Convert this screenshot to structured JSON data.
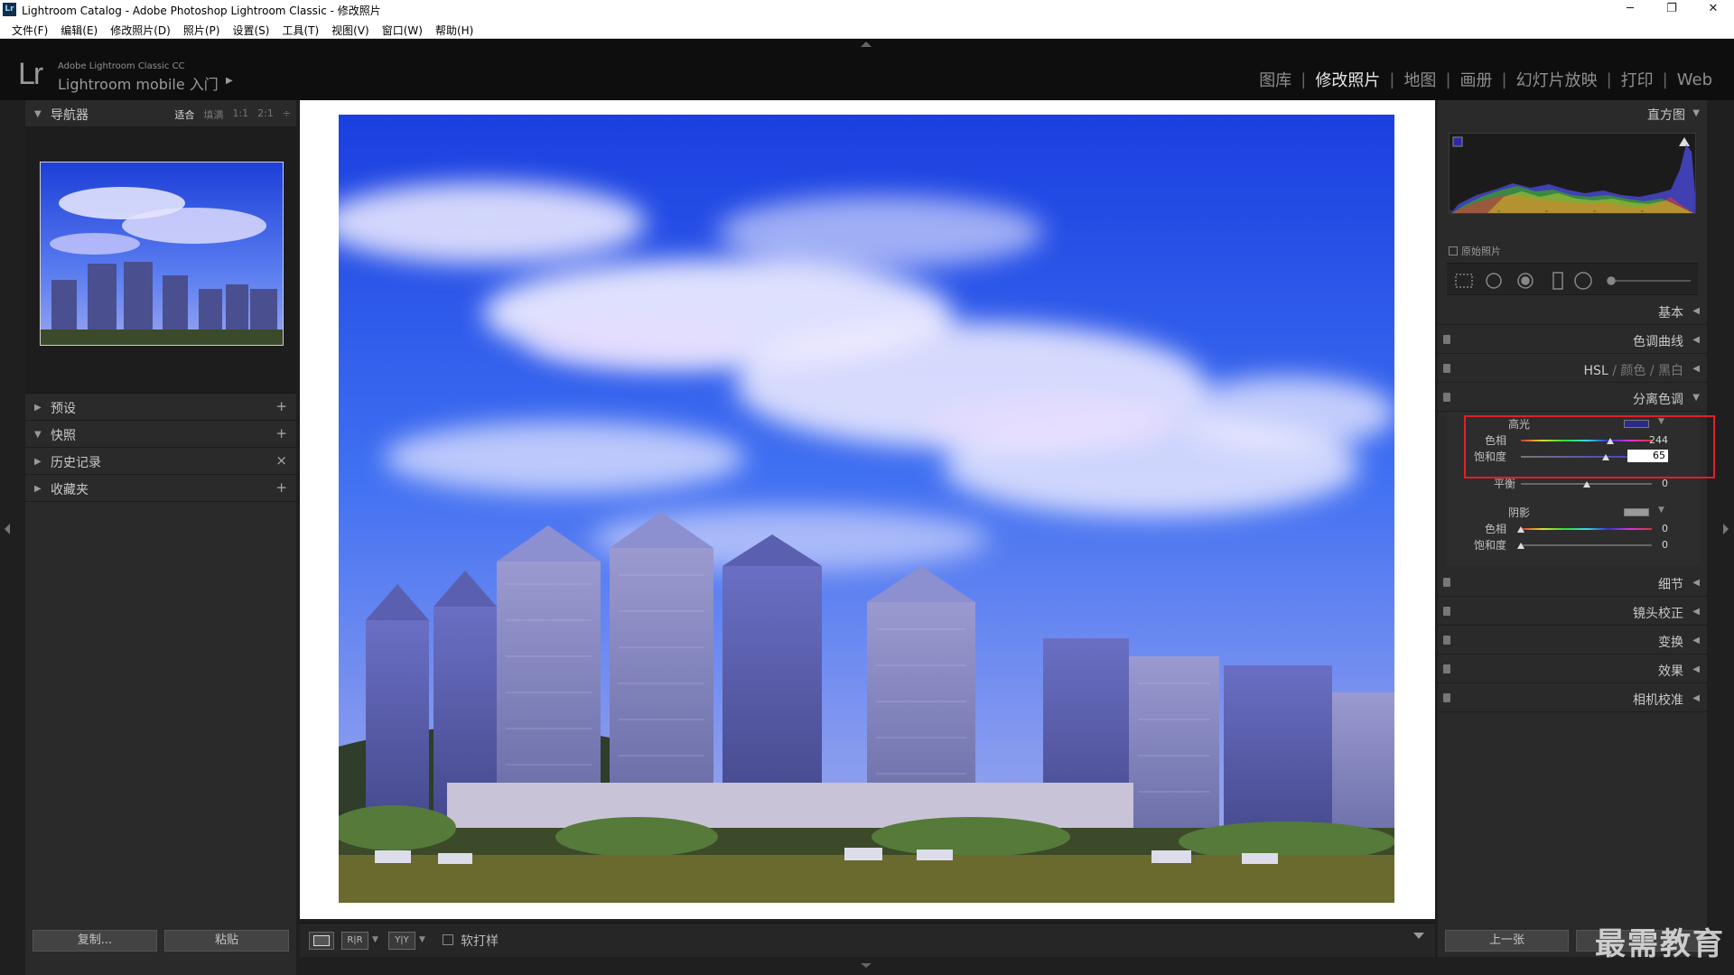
{
  "window": {
    "title": "Lightroom Catalog - Adobe Photoshop Lightroom Classic - 修改照片",
    "app_badge": "Lr",
    "minimize": "─",
    "restore": "❐",
    "close": "✕"
  },
  "menu": [
    "文件(F)",
    "编辑(E)",
    "修改照片(D)",
    "照片(P)",
    "设置(S)",
    "工具(T)",
    "视图(V)",
    "窗口(W)",
    "帮助(H)"
  ],
  "identity": {
    "logo": "Lr",
    "line1": "Adobe Lightroom Classic CC",
    "line2": "Lightroom mobile 入门",
    "arrow": "▶"
  },
  "modules": [
    {
      "label": "图库",
      "active": false
    },
    {
      "label": "修改照片",
      "active": true
    },
    {
      "label": "地图",
      "active": false
    },
    {
      "label": "画册",
      "active": false
    },
    {
      "label": "幻灯片放映",
      "active": false
    },
    {
      "label": "打印",
      "active": false
    },
    {
      "label": "Web",
      "active": false
    }
  ],
  "left_panel": {
    "navigator": {
      "label": "导航器",
      "zoom": [
        "适合",
        "填满",
        "1:1",
        "2:1"
      ],
      "zoom_stepper": "÷"
    },
    "presets": {
      "label": "预设",
      "ctrl": "+"
    },
    "snapshots": {
      "label": "快照",
      "ctrl": "+"
    },
    "history": {
      "label": "历史记录",
      "ctrl": "×"
    },
    "collections": {
      "label": "收藏夹",
      "ctrl": "+"
    },
    "copy_button": "复制...",
    "paste_button": "粘贴"
  },
  "toolbar": {
    "view_loupe": "",
    "view_ba": "R|R",
    "view_ba2": "Y|Y",
    "softproof": "软打样"
  },
  "right_panel": {
    "histogram": {
      "label": "直方图",
      "original_photo": "原始照片"
    },
    "sections": {
      "basic": "基本",
      "tone_curve": "色调曲线",
      "hsl": "HSL",
      "color": "颜色",
      "bw": "黑白",
      "split": "分离色调",
      "detail": "细节",
      "lens": "镜头校正",
      "transform": "变换",
      "effects": "效果",
      "calibration": "相机校准"
    },
    "split_toning": {
      "highlights_label": "高光",
      "hue_label": "色相",
      "hue_value": "244",
      "sat_label": "饱和度",
      "sat_value": "65",
      "balance_label": "平衡",
      "balance_value": "0",
      "shadows_label": "阴影",
      "sh_hue_label": "色相",
      "sh_hue_value": "0",
      "sh_sat_label": "饱和度",
      "sh_sat_value": "0",
      "highlight_color": "#2a2a8a"
    },
    "prev_button": "上一张",
    "reset_button": ""
  },
  "levels": {
    "highlight_hue": 0.68,
    "highlight_sat": 0.65,
    "balance": 0.5,
    "shadow_hue": 0,
    "shadow_sat": 0
  },
  "watermark": "最需教育"
}
